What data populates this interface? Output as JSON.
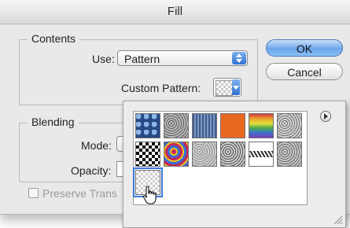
{
  "window": {
    "title": "Fill"
  },
  "contents": {
    "group_label": "Contents",
    "use_label": "Use:",
    "use_value": "Pattern",
    "custom_pattern_label": "Custom Pattern:"
  },
  "buttons": {
    "ok_label": "OK",
    "cancel_label": "Cancel"
  },
  "blending": {
    "group_label": "Blending",
    "mode_label": "Mode:",
    "opacity_label": "Opacity:",
    "preserve_label": "Preserve Trans"
  },
  "pattern_picker": {
    "menu_icon": "circle-arrow-right-icon",
    "selected_index": 12,
    "swatches": [
      {
        "name": "bubbles",
        "c1": "#274a86",
        "c2": "#8db7e8",
        "kind": "bubbles"
      },
      {
        "name": "gravel",
        "c1": "#5e5e5e",
        "c2": "#b8b8b8",
        "kind": "noise"
      },
      {
        "name": "blue-weave",
        "c1": "#3f5d8e",
        "c2": "#7f98c3",
        "kind": "weave"
      },
      {
        "name": "orange",
        "c1": "#e9681f",
        "c2": "#e9681f",
        "kind": "solid"
      },
      {
        "name": "rainbow",
        "c1": "#d9373b",
        "c2": "#48a84d",
        "kind": "rainbow"
      },
      {
        "name": "crumpled",
        "c1": "#6f6f6f",
        "c2": "#d2d2d2",
        "kind": "noise"
      },
      {
        "name": "black-checker",
        "c1": "#111111",
        "c2": "#ffffff",
        "kind": "checker"
      },
      {
        "name": "tie-dye",
        "c1": "#c7255a",
        "c2": "#356fd6",
        "kind": "tiedye"
      },
      {
        "name": "grain",
        "c1": "#8c8c8c",
        "c2": "#d0d0d0",
        "kind": "noise"
      },
      {
        "name": "speckle",
        "c1": "#4b4b4b",
        "c2": "#cfcfcf",
        "kind": "noise"
      },
      {
        "name": "rope",
        "c1": "#2d2d2d",
        "c2": "#ffffff",
        "kind": "rope"
      },
      {
        "name": "granite",
        "c1": "#6a6a6a",
        "c2": "#c6c6c6",
        "kind": "noise"
      },
      {
        "name": "transparent-checker",
        "c1": "#cfcfcf",
        "c2": "#ffffff",
        "kind": "checker-light"
      }
    ]
  }
}
